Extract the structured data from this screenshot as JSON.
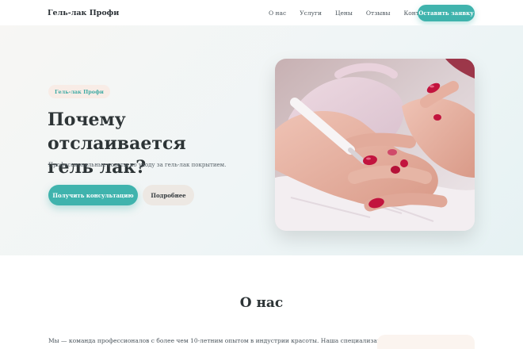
{
  "header": {
    "brand": "Гель-лак Профи",
    "nav": [
      "О нас",
      "Услуги",
      "Цены",
      "Отзывы",
      "Контакты"
    ],
    "cta_label": "Оставить заявку"
  },
  "hero": {
    "badge": "Гель-лак Профи",
    "title_line1": "Почему отслаивается",
    "title_line2": "гель лак?",
    "subtitle": "Профессиональные советы по уходу за гель-лак покрытием.",
    "primary_button": "Получить консультацию",
    "secondary_button": "Подробнее"
  },
  "about": {
    "title": "О нас",
    "text": "Мы — команда профессионалов с более чем 10-летним опытом в индустрии красоты. Наша специализация —"
  },
  "colors": {
    "accent": "#3fb3ad",
    "badge_bg": "#f8ece6",
    "secondary_bg": "#ede8e3",
    "text_dark": "#2d3436",
    "nail_red": "#c2143e"
  },
  "icons": []
}
